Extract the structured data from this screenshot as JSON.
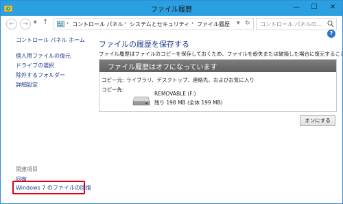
{
  "window": {
    "title": "ファイル履歴",
    "min_glyph": "—",
    "max_glyph": "☐",
    "close_glyph": "✕"
  },
  "addressbar": {
    "back_glyph": "←",
    "forward_glyph": "→",
    "history_glyph": "▾",
    "up_glyph": "↑",
    "breadcrumbs": [
      "コントロール パネル",
      "システムとセキュリティ",
      "ファイル履歴"
    ],
    "separator": "›",
    "dropdown_glyph": "▾",
    "refresh_glyph": "↻",
    "search_placeholder": "コントロール パネルの..."
  },
  "sidebar": {
    "home": "コントロール パネル ホーム",
    "items": [
      {
        "label": "個人用ファイルの復元"
      },
      {
        "label": "ドライブの選択"
      },
      {
        "label": "除外するフォルダー"
      },
      {
        "label": "詳細設定"
      }
    ],
    "related_heading": "関連項目",
    "related": [
      {
        "label": "回復"
      },
      {
        "label": "Windows 7 のファイルの回復"
      }
    ]
  },
  "main": {
    "heading": "ファイルの履歴を保存する",
    "description": "ファイル履歴はファイルのコピーを保存しておくため、ファイルを紛失または破損した場合に復元することができます。",
    "status_header": "ファイル履歴はオフになっています",
    "copy_from_label": "コピー元:",
    "copy_from_value": "ライブラリ、デスクトップ、連絡先、およびお気に入り",
    "copy_to_label": "コピー先:",
    "drive_name": "REMOVABLE (F:)",
    "drive_space": "残り 198 MB (全体 199 MB)",
    "on_button": "オンにする"
  },
  "help_glyph": "?",
  "colors": {
    "titlebar": "#2a9fe1",
    "link": "#1c3a8a",
    "highlight_box": "#e0001a",
    "panel_header": "#6e6e6e"
  }
}
